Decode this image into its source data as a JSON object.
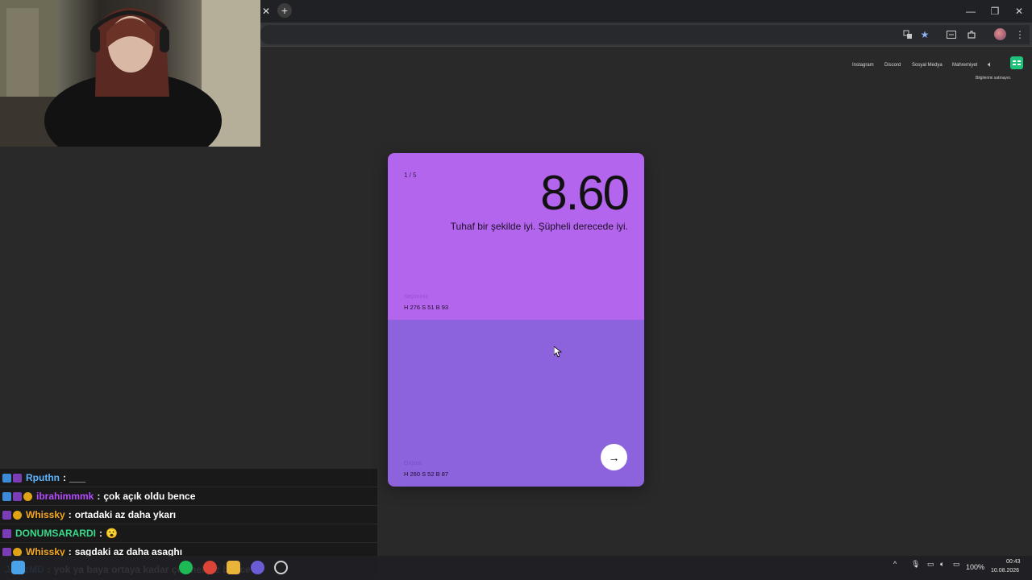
{
  "browser": {
    "tab_close": "✕",
    "new_tab": "+",
    "window_controls": {
      "minimize": "—",
      "restore": "❐",
      "close": "✕"
    },
    "toolbar_icons": [
      "translate-icon",
      "star-icon",
      "tab-search-icon",
      "extensions-icon",
      "profile-icon",
      "menu-icon"
    ]
  },
  "site": {
    "nav": [
      "Instagram",
      "Discord",
      "Sosyal Medya",
      "Mahremiyet"
    ],
    "privacy_note": "Bilgilerimi satmayın."
  },
  "card": {
    "round": "1 / 5",
    "score": "8.60",
    "feedback": "Tuhaf bir şekilde iyi. Şüpheli derecede iyi.",
    "selection_label": "Seçiminiz",
    "selection_value": "H 276 S 51 B 93",
    "original_label": "Orijinal",
    "original_value": "H 260 S 52 B 87",
    "colors": {
      "selection": "#b365ed",
      "original": "#8d62dd"
    }
  },
  "chat": [
    {
      "user": "Rputhn",
      "message": "___",
      "color": "#5ab4ff",
      "badges": [
        "blue",
        "purple"
      ]
    },
    {
      "user": "ibrahimmmk",
      "message": "çok açık oldu bence",
      "color": "#b44bff",
      "badges": [
        "blue",
        "purple",
        "gold"
      ]
    },
    {
      "user": "Whissky",
      "message": "ortadaki az daha ykarı",
      "color": "#f5a623",
      "badges": [
        "purple",
        "gold"
      ]
    },
    {
      "user": "DONUMSARARDI",
      "message": "😮",
      "color": "#39d98a",
      "badges": [
        "purple"
      ]
    },
    {
      "user": "Whissky",
      "message": "sagdaki az daha asaghı",
      "color": "#f5a623",
      "badges": [
        "purple",
        "gold"
      ]
    },
    {
      "user": "JamzMD",
      "message": "yok ya baya ortaya kadar çekmeliyiz bence",
      "color": "#5ab4ff",
      "badges": []
    }
  ],
  "taskbar": {
    "battery": "100%",
    "time": "00:43",
    "date": "10.08.2026"
  }
}
